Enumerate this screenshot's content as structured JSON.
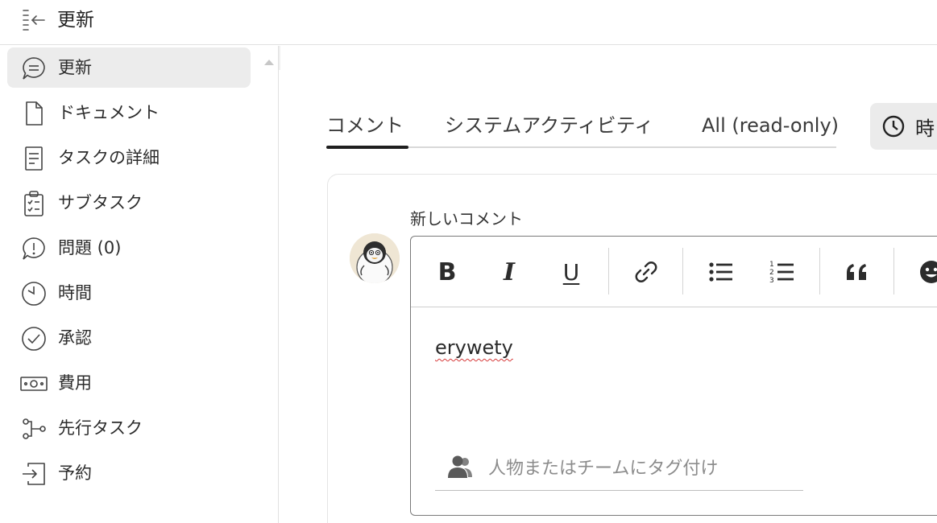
{
  "header": {
    "title": "更新",
    "collapse_icon": "collapse-panel-icon"
  },
  "sidebar": {
    "items": [
      {
        "label": "更新",
        "icon": "comment-icon",
        "active": true
      },
      {
        "label": "ドキュメント",
        "icon": "document-icon"
      },
      {
        "label": "タスクの詳細",
        "icon": "task-details-icon"
      },
      {
        "label": "サブタスク",
        "icon": "subtask-clipboard-icon"
      },
      {
        "label": "問題 (0)",
        "icon": "issue-icon"
      },
      {
        "label": "時間",
        "icon": "clock-icon"
      },
      {
        "label": "承認",
        "icon": "approval-check-icon"
      },
      {
        "label": "費用",
        "icon": "expense-money-icon"
      },
      {
        "label": "先行タスク",
        "icon": "predecessor-icon"
      },
      {
        "label": "予約",
        "icon": "booking-icon"
      }
    ]
  },
  "tabs": [
    {
      "label": "コメント",
      "active": true
    },
    {
      "label": "システムアクティビティ"
    },
    {
      "label": "All (read-only)"
    }
  ],
  "time_button": {
    "label": "時",
    "icon": "clock-icon"
  },
  "comment": {
    "heading": "新しいコメント",
    "text": "erywety",
    "tag_placeholder": "人物またはチームにタグ付け",
    "toolbar": [
      "bold",
      "italic",
      "underline",
      "link",
      "bulleted-list",
      "numbered-list",
      "quote",
      "emoji"
    ],
    "bold_glyph": "B",
    "italic_glyph": "I",
    "underline_glyph": "U"
  },
  "colors": {
    "active_item_bg": "#ececec",
    "active_tab_bar": "#1f1f1f",
    "spellcheck": "#d63a3a"
  }
}
